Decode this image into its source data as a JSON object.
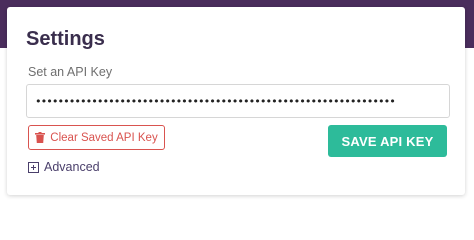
{
  "settings": {
    "title": "Settings",
    "api_key_label": "Set an API Key",
    "api_key_value": "••••••••••••••••••••••••••••••••••••••••••••••••••••••••••••••••",
    "clear_label": "Clear Saved API Key",
    "save_label": "SAVE API KEY",
    "advanced_label": "Advanced"
  },
  "icons": {
    "clear": "trash-icon",
    "advanced": "plus-square-icon"
  },
  "colors": {
    "header_bg": "#4a2d5c",
    "title": "#3a2e4d",
    "danger": "#d9534f",
    "primary": "#2dbb9a",
    "link": "#4a3f6b"
  }
}
